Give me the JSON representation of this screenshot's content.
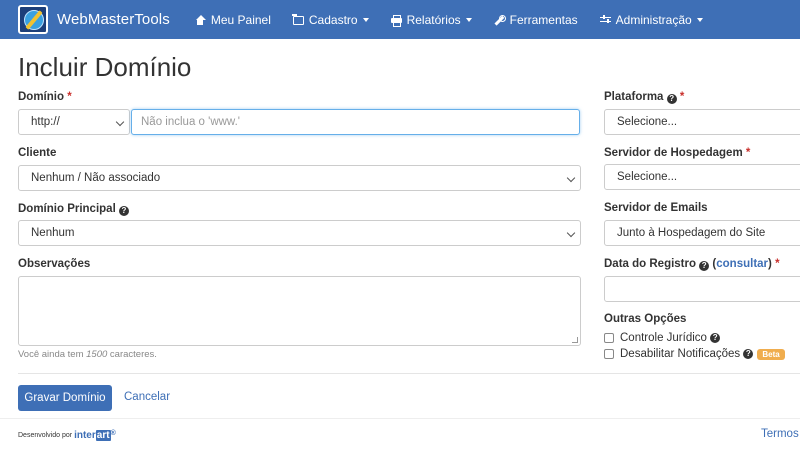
{
  "navbar": {
    "brand": "WebMasterTools",
    "items": [
      {
        "label": "Meu Painel"
      },
      {
        "label": "Cadastro"
      },
      {
        "label": "Relatórios"
      },
      {
        "label": "Ferramentas"
      },
      {
        "label": "Administração"
      }
    ]
  },
  "page": {
    "title": "Incluir Domínio"
  },
  "form": {
    "dominio": {
      "label": "Domínio",
      "protocol": "http://",
      "placeholder": "Não inclua o 'www.'"
    },
    "cliente": {
      "label": "Cliente",
      "value": "Nenhum / Não associado"
    },
    "dominio_principal": {
      "label": "Domínio Principal",
      "value": "Nenhum"
    },
    "observacoes": {
      "label": "Observações",
      "help_prefix": "Você ainda tem",
      "help_count": "1500",
      "help_suffix": "caracteres."
    },
    "plataforma": {
      "label": "Plataforma",
      "value": "Selecione..."
    },
    "servidor_hospedagem": {
      "label": "Servidor de Hospedagem",
      "value": "Selecione..."
    },
    "servidor_emails": {
      "label": "Servidor de Emails",
      "value": "Junto à Hospedagem do Site"
    },
    "data_registro": {
      "label": "Data do Registro",
      "open_paren": "(",
      "link": "consultar",
      "close_paren": ")"
    },
    "outras_opcoes": {
      "label": "Outras Opções",
      "controle_juridico": "Controle Jurídico",
      "desabilitar_notificacoes": "Desabilitar Notificações",
      "badge": "Beta"
    }
  },
  "actions": {
    "submit": "Gravar Domínio",
    "cancel": "Cancelar"
  },
  "footer": {
    "developed_by": "Desenvolvido por",
    "brand_inter": "inter",
    "brand_art": "art",
    "registered": "®",
    "terms": "Termos de"
  },
  "colors": {
    "primary": "#3e6fb6",
    "required": "#c9302c",
    "badge": "#f0ad4e"
  }
}
